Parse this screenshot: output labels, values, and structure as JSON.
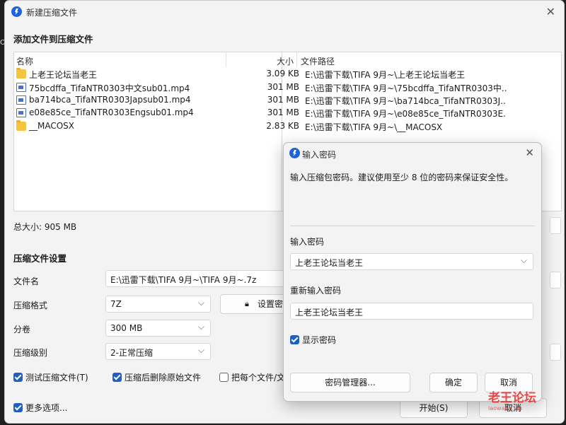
{
  "window": {
    "title": "新建压缩文件",
    "section_add": "添加文件到压缩文件"
  },
  "file_list": {
    "headers": {
      "name": "名称",
      "size": "大小",
      "path": "文件路径"
    },
    "rows": [
      {
        "icon": "folder-icon",
        "name": "上老王论坛当老王",
        "size": "3.09 KB",
        "path": "E:\\迅雷下载\\TIFA 9月~\\上老王论坛当老王"
      },
      {
        "icon": "file-icon",
        "name": "75bcdffa_TifaNTR0303中文sub01.mp4",
        "size": "301 MB",
        "path": "E:\\迅雷下载\\TIFA 9月~\\75bcdffa_TifaNTR0303中..."
      },
      {
        "icon": "file-icon",
        "name": "ba714bca_TifaNTR0303Japsub01.mp4",
        "size": "301 MB",
        "path": "E:\\迅雷下载\\TIFA 9月~\\ba714bca_TifaNTR0303J..."
      },
      {
        "icon": "file-icon",
        "name": "e08e85ce_TifaNTR0303Engsub01.mp4",
        "size": "301 MB",
        "path": "E:\\迅雷下载\\TIFA 9月~\\e08e85ce_TifaNTR0303E..."
      },
      {
        "icon": "folder-icon",
        "name": "__MACOSX",
        "size": "2.83 KB",
        "path": "E:\\迅雷下载\\TIFA 9月~\\__MACOSX"
      }
    ]
  },
  "total_size": "总大小: 905 MB",
  "settings": {
    "section": "压缩文件设置",
    "filename_label": "文件名",
    "filename_value": "E:\\迅雷下载\\TIFA 9月~\\TIFA 9月~.7z",
    "format_label": "压缩格式",
    "format_value": "7Z",
    "set_password_button": "设置密",
    "volume_label": "分卷",
    "volume_value": "300 MB",
    "level_label": "压缩级别",
    "level_value": "2-正常压缩",
    "test_archive": "测试压缩文件(T)",
    "delete_after": "压缩后删除原始文件",
    "each_file": "把每个文件/文",
    "more_options": "更多选项...",
    "start_button": "开始(S)",
    "cancel_button": "取消"
  },
  "password_dialog": {
    "title": "输入密码",
    "description": "输入压缩包密码。建议使用至少 8 位的密码来保证安全性。",
    "password_label": "输入密码",
    "password_value": "上老王论坛当老王",
    "reenter_label": "重新输入密码",
    "reenter_value": "上老王论坛当老王",
    "show_password": "显示密码",
    "manager_button": "密码管理器...",
    "ok_button": "确定",
    "cancel_button": "取消"
  },
  "watermark": {
    "main": "老王论坛",
    "sub": "laowang.vip"
  },
  "colors": {
    "accent": "#1f5fbf",
    "watermark": "#e62828"
  }
}
